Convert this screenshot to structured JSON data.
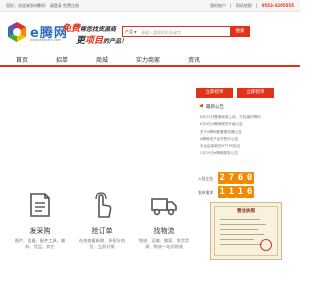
{
  "topbar": {
    "left": "您好，欢迎来到e腾网！  请登录  免费注册",
    "links": [
      "我的账户",
      "|",
      "网站地图",
      "|"
    ],
    "phone": "0553-3205555"
  },
  "header": {
    "logo_text": "e腾网",
    "logo_url": "www.eqteam.com",
    "slogan_free": "免费",
    "slogan_line1_rest": "帮您找货源商",
    "slogan_line2_pre": "更",
    "slogan_line2_hl": "项目",
    "slogan_line2_post": "的产品！"
  },
  "search": {
    "category": "产品",
    "placeholder": "请输入要搜索的关键字",
    "button_label": "搜索"
  },
  "nav": {
    "items": [
      "首页",
      "招单",
      "商城",
      "实力商家",
      "资讯"
    ]
  },
  "sidebar": {
    "btn_buy": "立即招单",
    "btn_sell": "立即招单",
    "announce_title": "最新公告",
    "announcements": [
      "6月23日曹操商城上线，打包福利等你",
      "6月5日e腾网服务升级公告",
      "关于e腾网配置服务器公告",
      "e腾网电子证书签约公告",
      "平台启用新的HTTPS协议",
      "2月19日e腾网服务公告"
    ],
    "stats": [
      {
        "label": "入驻企业",
        "value": "2760"
      },
      {
        "label": "发布需求",
        "value": "1116"
      }
    ],
    "cert_title": "营业执照"
  },
  "features": [
    {
      "title": "发采购",
      "desc": "图片、设备、配件工具、辅料、货品、其它"
    },
    {
      "title": "抢订单",
      "desc": "在线查看新增、多权分档位、立即对接"
    },
    {
      "title": "找物流",
      "desc": "物流、运输、搬家、发货货源、物流一站式物流"
    }
  ],
  "colors": {
    "accent": "#e0331a",
    "digit_bg": "#f08a00",
    "brand_blue": "#2f6dbb"
  }
}
